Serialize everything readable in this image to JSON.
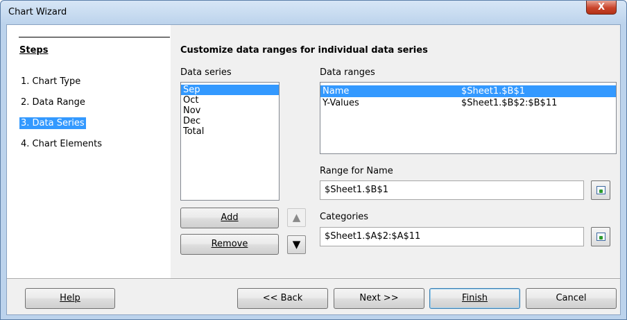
{
  "window": {
    "title": "Chart Wizard",
    "close_symbol": "X"
  },
  "steps": {
    "heading": "Steps",
    "items": [
      {
        "label": "1. Chart Type",
        "selected": false
      },
      {
        "label": "2. Data Range",
        "selected": false
      },
      {
        "label": "3. Data Series",
        "selected": true
      },
      {
        "label": "4. Chart Elements",
        "selected": false
      }
    ]
  },
  "main": {
    "title": "Customize data ranges for individual data series",
    "data_series_label": "Data series",
    "data_series": [
      "Sep",
      "Oct",
      "Nov",
      "Dec",
      "Total"
    ],
    "data_ranges_label": "Data ranges",
    "data_ranges": [
      {
        "role": "Name",
        "range": "$Sheet1.$B$1"
      },
      {
        "role": "Y-Values",
        "range": "$Sheet1.$B$2:$B$11"
      }
    ],
    "range_for_name_label": "Range for Name",
    "range_for_name_value": "$Sheet1.$B$1",
    "categories_label": "Categories",
    "categories_value": "$Sheet1.$A$2:$A$11",
    "add_label": "Add",
    "remove_label": "Remove",
    "move_up_symbol": "▲",
    "move_down_symbol": "▼"
  },
  "footer": {
    "help_label": "Help",
    "back_label": "<< Back",
    "next_label": "Next >>",
    "finish_label": "Finish",
    "cancel_label": "Cancel"
  },
  "colors": {
    "selection": "#3399ff",
    "title_bar": "#bcd3ec",
    "close_button": "#c9432a"
  }
}
